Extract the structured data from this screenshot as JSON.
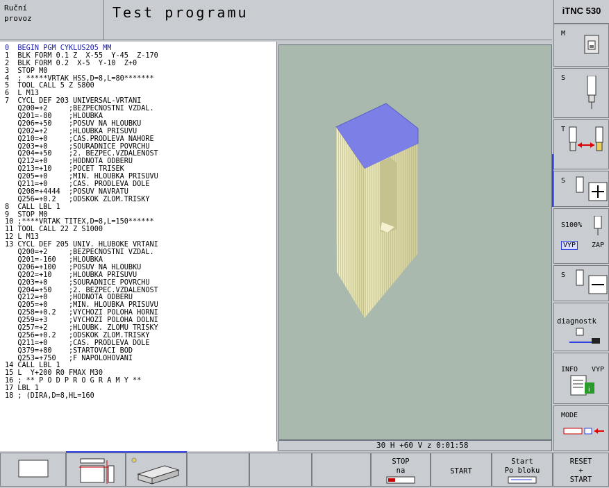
{
  "header": {
    "mode_line1": "Ruční",
    "mode_line2": "provoz",
    "title": "Test programu",
    "brand": "iTNC 530"
  },
  "program_lines": [
    "0  BEGIN PGM CYKLUS205 MM",
    "1  BLK FORM 0.1 Z  X-55  Y-45  Z-170",
    "2  BLK FORM 0.2  X-5  Y-10  Z+0",
    "3  STOP M0",
    "4  ; *****VRTAK HSS,D=8,L=80*******",
    "5  TOOL CALL 5 Z S800",
    "6  L M13",
    "7  CYCL DEF 203 UNIVERSAL-VRTANI",
    "   Q200=+2     ;BEZPECNOSTNI VZDAL.",
    "   Q201=-80    ;HLOUBKA",
    "   Q206=+50    ;POSUV NA HLOUBKU",
    "   Q202=+2     ;HLOUBKA PRISUVU",
    "   Q210=+0     ;CAS.PRODLEVA NAHORE",
    "   Q203=+0     ;SOURADNICE POVRCHU",
    "   Q204=+50    ;2. BEZPEC.VZDALENOST",
    "   Q212=+0     ;HODNOTA ODBERU",
    "   Q213=+10    ;POCET TRISEK",
    "   Q205=+0     ;MIN. HLOUBKA PRISUVU",
    "   Q211=+0     ;CAS. PRODLEVA DOLE",
    "   Q208=+4444  ;POSUV NAVRATU",
    "   Q256=+0.2   ;ODSKOK ZLOM.TRISKY",
    "8  CALL LBL 1",
    "9  STOP M0",
    "10 ;****VRTAK TITEX,D=8,L=150******",
    "11 TOOL CALL 22 Z S1000",
    "12 L M13",
    "13 CYCL DEF 205 UNIV. HLUBOKE VRTANI",
    "   Q200=+2     ;BEZPECNOSTNI VZDAL.",
    "   Q201=-160   ;HLOUBKA",
    "   Q206=+100   ;POSUV NA HLOUBKU",
    "   Q202=+10    ;HLOUBKA PRISUVU",
    "   Q203=+0     ;SOURADNICE POVRCHU",
    "   Q204=+50    ;2. BEZPEC.VZDALENOST",
    "   Q212=+0     ;HODNOTA ODBERU",
    "   Q205=+0     ;MIN. HLOUBKA PRISUVU",
    "   Q258=+0.2   ;VYCHOZI POLOHA HORNI",
    "   Q259=+3     ;VYCHOZI POLOHA DOLNI",
    "   Q257=+2     ;HLOUBK. ZLOMU TRISKY",
    "   Q256=+0.2   ;ODSKOK ZLOM.TRISKY",
    "   Q211=+0     ;CAS. PRODLEVA DOLE",
    "   Q379=+80    ;STARTOVACI BOD",
    "   Q253=+750   ;F NAPOLOHOVANI",
    "14 CALL LBL 1",
    "15 L  Y+200 R0 FMAX M30",
    "16 ; ** P O D P R O G R A M Y **",
    "17 LBL 1",
    "18 ; (DIRA,D=8,HL=160"
  ],
  "status_bar": {
    "text": "30 H +60 V z    0:01:58"
  },
  "right_softkeys": {
    "m_label": "M",
    "s_label": "S",
    "t_label": "T",
    "s_plus_label": "S",
    "s100_label": "S100%",
    "vyp": "VYP",
    "zap": "ZAP",
    "s_minus_label": "S",
    "diagnostics": "diagnostk",
    "info": "INFO",
    "info_state": "VYP",
    "mode": "MODE"
  },
  "bottom_softkeys": {
    "stop_line1": "STOP",
    "stop_line2": "na",
    "start": "START",
    "start_block_line1": "Start",
    "start_block_line2": "Po bloku",
    "reset_line1": "RESET",
    "reset_line2": "+",
    "reset_line3": "START"
  },
  "colors": {
    "graphics_bg": "#a9b9ad",
    "block_top": "#7b7fe6",
    "block_side": "#e6e4b4",
    "accent_blue": "#2f3fe0"
  }
}
